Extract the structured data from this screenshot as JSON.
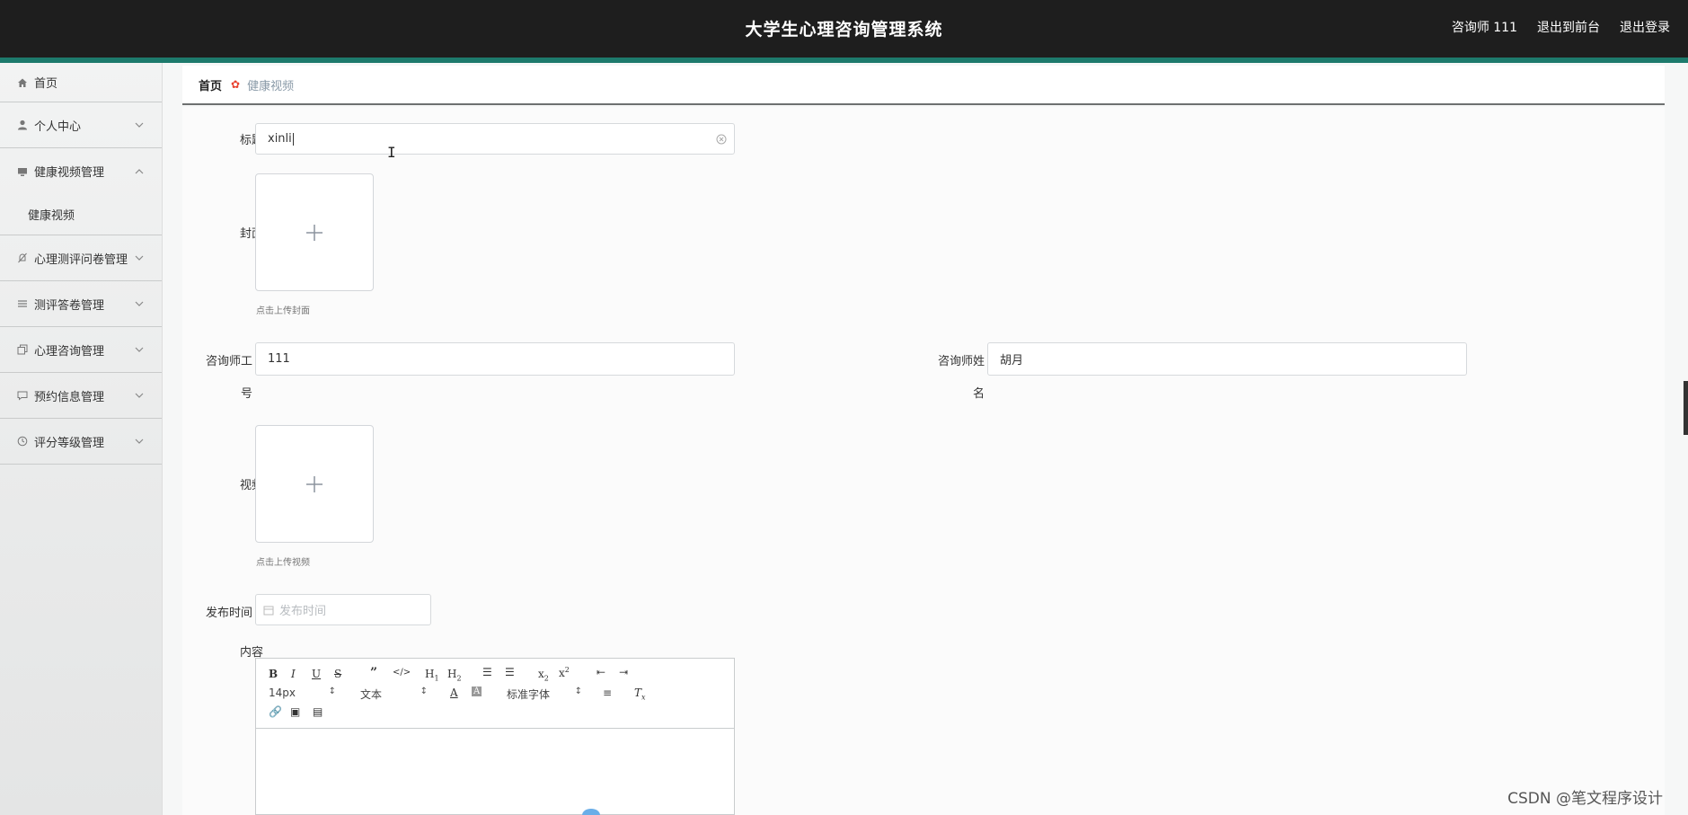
{
  "header": {
    "title": "大学生心理咨询管理系统",
    "user_label": "咨询师 111",
    "back_to_front": "退出到前台",
    "logout": "退出登录"
  },
  "sidebar": {
    "items": [
      {
        "label": "首页",
        "icon": "home-icon"
      },
      {
        "label": "个人中心",
        "icon": "user-icon"
      },
      {
        "label": "健康视频管理",
        "icon": "monitor-icon",
        "expanded": true,
        "children": [
          "健康视频"
        ]
      },
      {
        "label": "心理测评问卷管理",
        "icon": "bell-off-icon"
      },
      {
        "label": "测评答卷管理",
        "icon": "list-icon"
      },
      {
        "label": "心理咨询管理",
        "icon": "copy-icon"
      },
      {
        "label": "预约信息管理",
        "icon": "chat-icon"
      },
      {
        "label": "评分等级管理",
        "icon": "clock-icon"
      }
    ]
  },
  "breadcrumb": {
    "home": "首页",
    "current": "健康视频"
  },
  "form": {
    "title_label": "标题",
    "title_value": "xinli",
    "cover_label": "封面",
    "cover_hint": "点击上传封面",
    "counselor_no_label_1": "咨询师工",
    "counselor_no_label_2": "号",
    "counselor_no_value": "111",
    "counselor_name_label_1": "咨询师姓",
    "counselor_name_label_2": "名",
    "counselor_name_value": "胡月",
    "video_label": "视频",
    "video_hint": "点击上传视频",
    "publish_label": "发布时间",
    "publish_placeholder": "发布时间",
    "content_label": "内容"
  },
  "editor": {
    "font_size": "14px",
    "block_type": "文本",
    "font_family": "标准字体"
  },
  "watermark": "CSDN @笔文程序设计",
  "colors": {
    "header_bg": "#1e1e1e",
    "accent": "#1d7a6c",
    "breadcrumb_sep": "#e8412e"
  }
}
